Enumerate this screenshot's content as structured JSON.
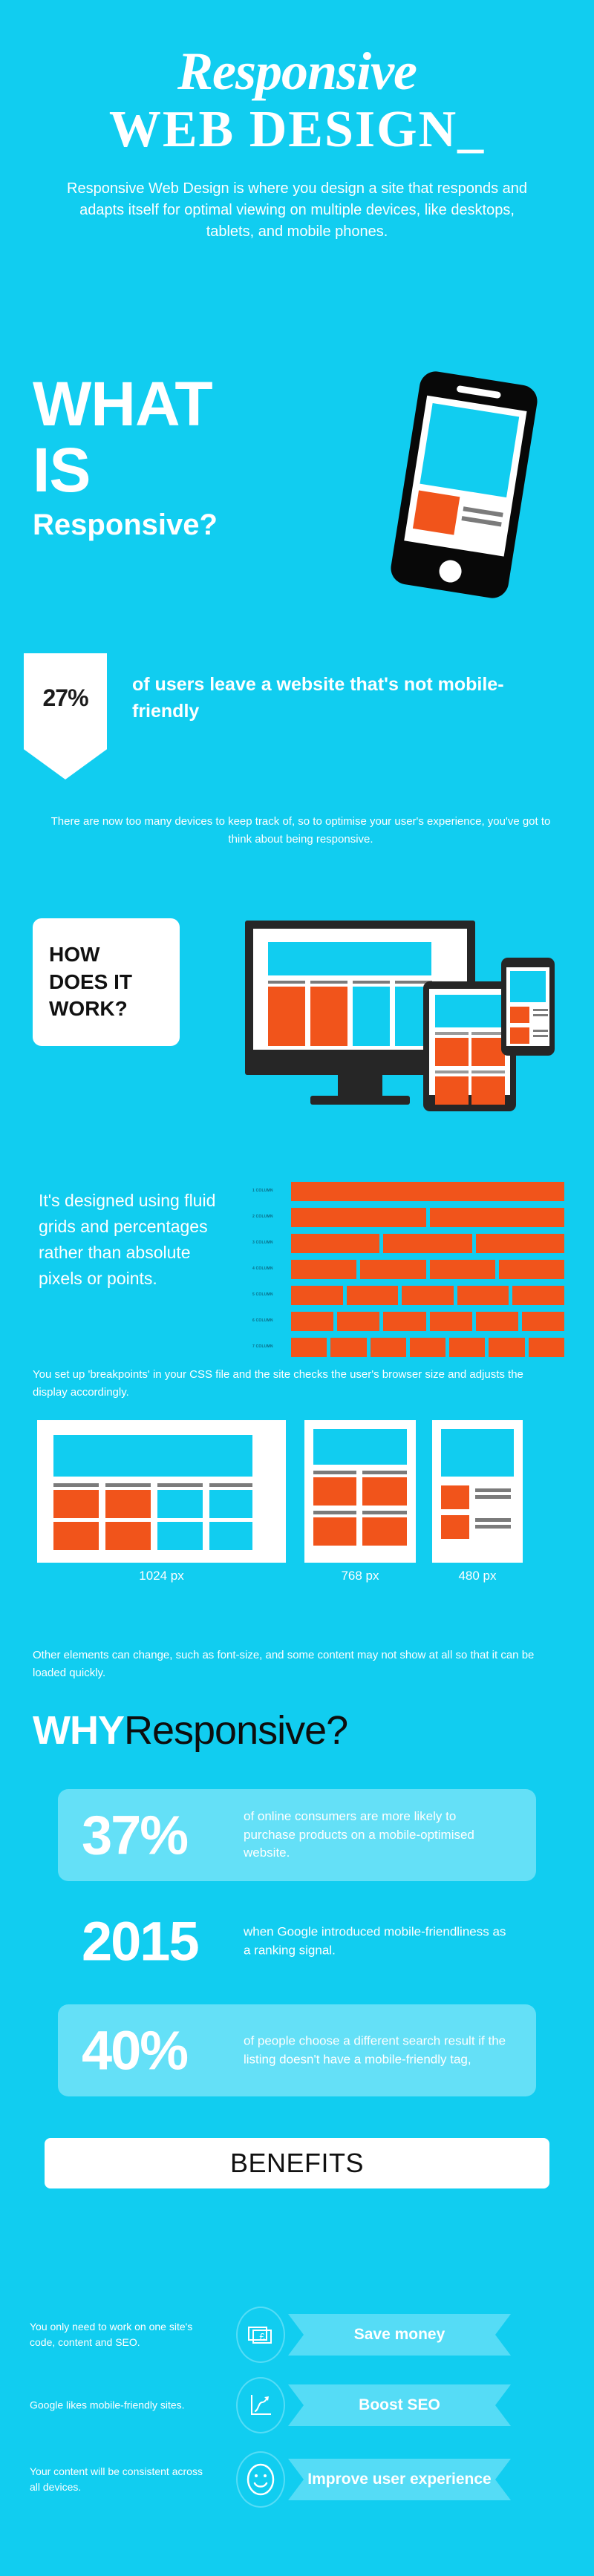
{
  "header": {
    "title_line1": "Responsive",
    "title_line2": "WEB DESIGN_",
    "subtitle": "Responsive Web Design is where you design a site that responds and adapts itself for optimal viewing on multiple devices, like desktops, tablets, and mobile phones."
  },
  "what_is": {
    "line1": "WHAT",
    "line2": "IS",
    "line3": "Responsive?"
  },
  "stat_ribbon": {
    "value": "27%",
    "text": "of users leave a website that's not mobile-friendly",
    "note": "There are now too many devices to keep track of, so to optimise your user's experience, you've got to think about being responsive."
  },
  "how": {
    "line1": "HOW",
    "line2": "DOES IT",
    "line3": "WORK?"
  },
  "fluid": {
    "text": "It's designed using fluid grids and percentages rather than absolute pixels or points.",
    "note": "You set up 'breakpoints' in your CSS file and the site checks the user's browser size and adjusts the display accordingly.",
    "grid_rows": [
      {
        "label": "1 COLUMN",
        "columns": 1
      },
      {
        "label": "2 COLUMN",
        "columns": 2
      },
      {
        "label": "3 COLUMN",
        "columns": 3
      },
      {
        "label": "4 COLUMN",
        "columns": 4
      },
      {
        "label": "5 COLUMN",
        "columns": 5
      },
      {
        "label": "6 COLUMN",
        "columns": 6
      },
      {
        "label": "7 COLUMN",
        "columns": 7
      }
    ]
  },
  "breakpoints": {
    "labels": [
      "1024 px",
      "768 px",
      "480 px"
    ],
    "note": "Other elements can change, such as font-size, and some content may not show at all so that it can be loaded quickly."
  },
  "why": {
    "bold_part": "WHY",
    "light_part": "Responsive?"
  },
  "stats": [
    {
      "number": "37%",
      "text": "of online consumers are more likely to purchase products on a mobile-optimised website.",
      "card": true
    },
    {
      "number": "2015",
      "text": "when Google introduced mobile-friendliness as a ranking signal.",
      "card": false
    },
    {
      "number": "40%",
      "text": "of people choose a different search result if the listing doesn't have a mobile-friendly tag,",
      "card": true
    }
  ],
  "benefits": {
    "heading": "BENEFITS",
    "items": [
      {
        "text": "You only need to work on one site's code, content and SEO.",
        "icon": "money-note-icon",
        "label": "Save money"
      },
      {
        "text": "Google likes mobile-friendly sites.",
        "icon": "growth-chart-icon",
        "label": "Boost SEO"
      },
      {
        "text": "Your content will be consistent across all devices.",
        "icon": "smiley-face-icon",
        "label": "Improve user experience"
      }
    ]
  },
  "colors": {
    "background": "#11CDF0",
    "accent_orange": "#F1541B",
    "card": "#64E0F7",
    "dark": "#262626",
    "white": "#FFFFFF"
  }
}
